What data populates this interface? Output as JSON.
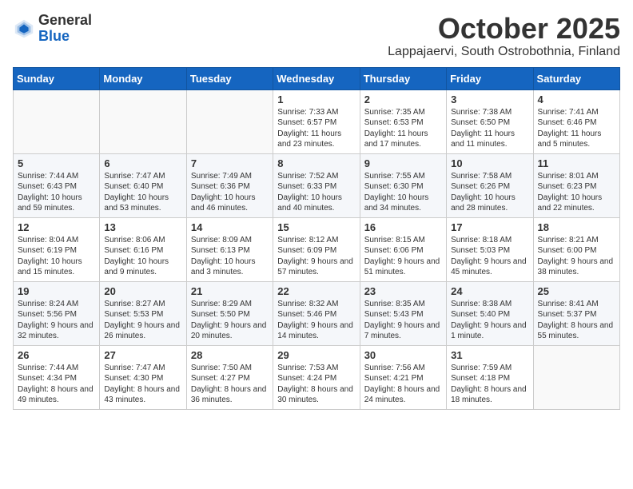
{
  "logo": {
    "general": "General",
    "blue": "Blue"
  },
  "header": {
    "month": "October 2025",
    "location": "Lappajaervi, South Ostrobothnia, Finland"
  },
  "weekdays": [
    "Sunday",
    "Monday",
    "Tuesday",
    "Wednesday",
    "Thursday",
    "Friday",
    "Saturday"
  ],
  "weeks": [
    [
      {
        "day": "",
        "sunrise": "",
        "sunset": "",
        "daylight": ""
      },
      {
        "day": "",
        "sunrise": "",
        "sunset": "",
        "daylight": ""
      },
      {
        "day": "",
        "sunrise": "",
        "sunset": "",
        "daylight": ""
      },
      {
        "day": "1",
        "sunrise": "Sunrise: 7:33 AM",
        "sunset": "Sunset: 6:57 PM",
        "daylight": "Daylight: 11 hours and 23 minutes."
      },
      {
        "day": "2",
        "sunrise": "Sunrise: 7:35 AM",
        "sunset": "Sunset: 6:53 PM",
        "daylight": "Daylight: 11 hours and 17 minutes."
      },
      {
        "day": "3",
        "sunrise": "Sunrise: 7:38 AM",
        "sunset": "Sunset: 6:50 PM",
        "daylight": "Daylight: 11 hours and 11 minutes."
      },
      {
        "day": "4",
        "sunrise": "Sunrise: 7:41 AM",
        "sunset": "Sunset: 6:46 PM",
        "daylight": "Daylight: 11 hours and 5 minutes."
      }
    ],
    [
      {
        "day": "5",
        "sunrise": "Sunrise: 7:44 AM",
        "sunset": "Sunset: 6:43 PM",
        "daylight": "Daylight: 10 hours and 59 minutes."
      },
      {
        "day": "6",
        "sunrise": "Sunrise: 7:47 AM",
        "sunset": "Sunset: 6:40 PM",
        "daylight": "Daylight: 10 hours and 53 minutes."
      },
      {
        "day": "7",
        "sunrise": "Sunrise: 7:49 AM",
        "sunset": "Sunset: 6:36 PM",
        "daylight": "Daylight: 10 hours and 46 minutes."
      },
      {
        "day": "8",
        "sunrise": "Sunrise: 7:52 AM",
        "sunset": "Sunset: 6:33 PM",
        "daylight": "Daylight: 10 hours and 40 minutes."
      },
      {
        "day": "9",
        "sunrise": "Sunrise: 7:55 AM",
        "sunset": "Sunset: 6:30 PM",
        "daylight": "Daylight: 10 hours and 34 minutes."
      },
      {
        "day": "10",
        "sunrise": "Sunrise: 7:58 AM",
        "sunset": "Sunset: 6:26 PM",
        "daylight": "Daylight: 10 hours and 28 minutes."
      },
      {
        "day": "11",
        "sunrise": "Sunrise: 8:01 AM",
        "sunset": "Sunset: 6:23 PM",
        "daylight": "Daylight: 10 hours and 22 minutes."
      }
    ],
    [
      {
        "day": "12",
        "sunrise": "Sunrise: 8:04 AM",
        "sunset": "Sunset: 6:19 PM",
        "daylight": "Daylight: 10 hours and 15 minutes."
      },
      {
        "day": "13",
        "sunrise": "Sunrise: 8:06 AM",
        "sunset": "Sunset: 6:16 PM",
        "daylight": "Daylight: 10 hours and 9 minutes."
      },
      {
        "day": "14",
        "sunrise": "Sunrise: 8:09 AM",
        "sunset": "Sunset: 6:13 PM",
        "daylight": "Daylight: 10 hours and 3 minutes."
      },
      {
        "day": "15",
        "sunrise": "Sunrise: 8:12 AM",
        "sunset": "Sunset: 6:09 PM",
        "daylight": "Daylight: 9 hours and 57 minutes."
      },
      {
        "day": "16",
        "sunrise": "Sunrise: 8:15 AM",
        "sunset": "Sunset: 6:06 PM",
        "daylight": "Daylight: 9 hours and 51 minutes."
      },
      {
        "day": "17",
        "sunrise": "Sunrise: 8:18 AM",
        "sunset": "Sunset: 5:03 PM",
        "daylight": "Daylight: 9 hours and 45 minutes."
      },
      {
        "day": "18",
        "sunrise": "Sunrise: 8:21 AM",
        "sunset": "Sunset: 6:00 PM",
        "daylight": "Daylight: 9 hours and 38 minutes."
      }
    ],
    [
      {
        "day": "19",
        "sunrise": "Sunrise: 8:24 AM",
        "sunset": "Sunset: 5:56 PM",
        "daylight": "Daylight: 9 hours and 32 minutes."
      },
      {
        "day": "20",
        "sunrise": "Sunrise: 8:27 AM",
        "sunset": "Sunset: 5:53 PM",
        "daylight": "Daylight: 9 hours and 26 minutes."
      },
      {
        "day": "21",
        "sunrise": "Sunrise: 8:29 AM",
        "sunset": "Sunset: 5:50 PM",
        "daylight": "Daylight: 9 hours and 20 minutes."
      },
      {
        "day": "22",
        "sunrise": "Sunrise: 8:32 AM",
        "sunset": "Sunset: 5:46 PM",
        "daylight": "Daylight: 9 hours and 14 minutes."
      },
      {
        "day": "23",
        "sunrise": "Sunrise: 8:35 AM",
        "sunset": "Sunset: 5:43 PM",
        "daylight": "Daylight: 9 hours and 7 minutes."
      },
      {
        "day": "24",
        "sunrise": "Sunrise: 8:38 AM",
        "sunset": "Sunset: 5:40 PM",
        "daylight": "Daylight: 9 hours and 1 minute."
      },
      {
        "day": "25",
        "sunrise": "Sunrise: 8:41 AM",
        "sunset": "Sunset: 5:37 PM",
        "daylight": "Daylight: 8 hours and 55 minutes."
      }
    ],
    [
      {
        "day": "26",
        "sunrise": "Sunrise: 7:44 AM",
        "sunset": "Sunset: 4:34 PM",
        "daylight": "Daylight: 8 hours and 49 minutes."
      },
      {
        "day": "27",
        "sunrise": "Sunrise: 7:47 AM",
        "sunset": "Sunset: 4:30 PM",
        "daylight": "Daylight: 8 hours and 43 minutes."
      },
      {
        "day": "28",
        "sunrise": "Sunrise: 7:50 AM",
        "sunset": "Sunset: 4:27 PM",
        "daylight": "Daylight: 8 hours and 36 minutes."
      },
      {
        "day": "29",
        "sunrise": "Sunrise: 7:53 AM",
        "sunset": "Sunset: 4:24 PM",
        "daylight": "Daylight: 8 hours and 30 minutes."
      },
      {
        "day": "30",
        "sunrise": "Sunrise: 7:56 AM",
        "sunset": "Sunset: 4:21 PM",
        "daylight": "Daylight: 8 hours and 24 minutes."
      },
      {
        "day": "31",
        "sunrise": "Sunrise: 7:59 AM",
        "sunset": "Sunset: 4:18 PM",
        "daylight": "Daylight: 8 hours and 18 minutes."
      },
      {
        "day": "",
        "sunrise": "",
        "sunset": "",
        "daylight": ""
      }
    ]
  ]
}
